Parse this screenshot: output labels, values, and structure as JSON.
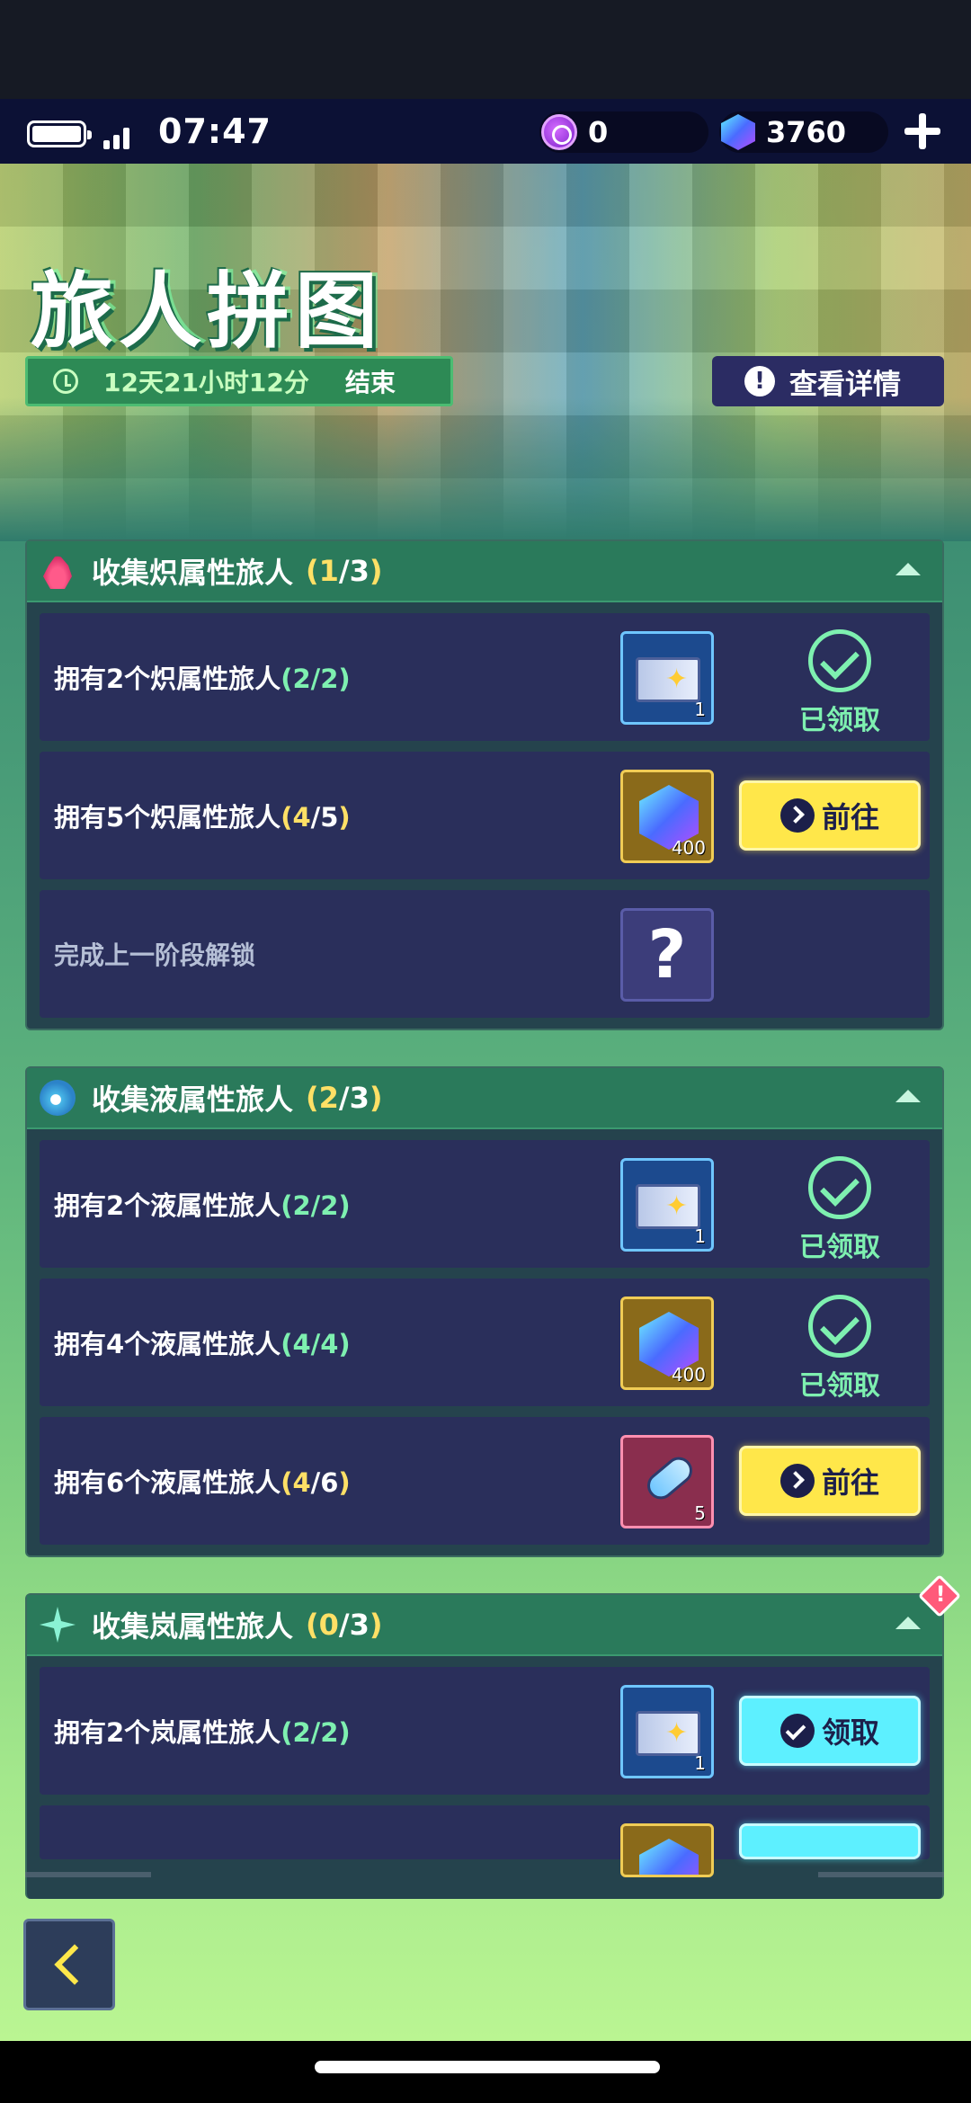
{
  "status": {
    "time": "07:47"
  },
  "currency": {
    "points": "0",
    "gems": "3760"
  },
  "event": {
    "title": "旅人拼图",
    "timer": "12天21小时12分",
    "timer_end": "结束",
    "detail_label": "查看详情"
  },
  "sections": [
    {
      "name": "收集炽属性旅人",
      "prog_open": "(",
      "prog_done": "1",
      "prog_slash": "/",
      "prog_total": "3",
      "prog_close": ")",
      "rows": [
        {
          "pre": "拥有2个炽属性旅人",
          "po": "(",
          "done": "2",
          "sl": "/",
          "total": "2",
          "pc": ")",
          "reward_qty": "1",
          "status": "已领取"
        },
        {
          "pre": "拥有5个炽属性旅人",
          "po": "(",
          "done": "4",
          "sl": "/",
          "total": "5",
          "pc": ")",
          "reward_qty": "400",
          "status": "前往"
        },
        {
          "pre": "完成上一阶段解锁",
          "reward_q": "?"
        }
      ]
    },
    {
      "name": "收集液属性旅人",
      "prog_open": "(",
      "prog_done": "2",
      "prog_slash": "/",
      "prog_total": "3",
      "prog_close": ")",
      "rows": [
        {
          "pre": "拥有2个液属性旅人",
          "po": "(",
          "done": "2",
          "sl": "/",
          "total": "2",
          "pc": ")",
          "reward_qty": "1",
          "status": "已领取"
        },
        {
          "pre": "拥有4个液属性旅人",
          "po": "(",
          "done": "4",
          "sl": "/",
          "total": "4",
          "pc": ")",
          "reward_qty": "400",
          "status": "已领取"
        },
        {
          "pre": "拥有6个液属性旅人",
          "po": "(",
          "done": "4",
          "sl": "/",
          "total": "6",
          "pc": ")",
          "reward_qty": "5",
          "status": "前往"
        }
      ]
    },
    {
      "name": "收集岚属性旅人",
      "prog_open": "(",
      "prog_done": "0",
      "prog_slash": "/",
      "prog_total": "3",
      "prog_close": ")",
      "rows": [
        {
          "pre": "拥有2个岚属性旅人",
          "po": "(",
          "done": "2",
          "sl": "/",
          "total": "2",
          "pc": ")",
          "reward_qty": "1",
          "status": "领取"
        }
      ]
    }
  ],
  "colors": {
    "accent_green": "#7ef0b0",
    "accent_yellow": "#ffe74a",
    "accent_cyan": "#5df0ff",
    "panel": "#25434d"
  }
}
